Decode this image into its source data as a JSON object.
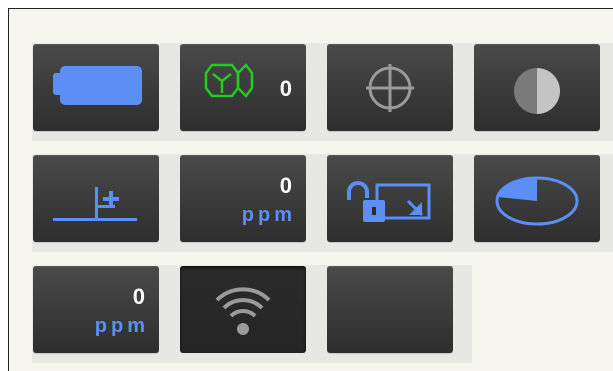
{
  "screen": {
    "status_icons": [
      {
        "id": "battery",
        "icon": "battery-icon"
      },
      {
        "id": "prism",
        "icon": "prism-icon",
        "value": "0"
      },
      {
        "id": "target",
        "icon": "crosshair-target-icon"
      },
      {
        "id": "laser",
        "icon": "half-circle-contrast-icon"
      },
      {
        "id": "instrument-height",
        "icon": "height-offset-icon"
      },
      {
        "id": "ppm-a",
        "icon": "ppm-correction",
        "value": "0",
        "unit": "ppm"
      },
      {
        "id": "lock",
        "icon": "unlock-screen-icon"
      },
      {
        "id": "disk",
        "icon": "disk-capacity-icon"
      },
      {
        "id": "ppm-b",
        "icon": "ppm-correction",
        "value": "0",
        "unit": "ppm"
      },
      {
        "id": "wireless",
        "icon": "wifi-signal-icon"
      },
      {
        "id": "blank",
        "icon": ""
      }
    ],
    "colors": {
      "panel_bg": "#f6f6ef",
      "band_bg": "#e7e7e4",
      "button_dark": "#3a3a3a",
      "accent_blue": "#5b8ff5",
      "prism_green": "#22cc22",
      "icon_gray": "#9a9a9a"
    }
  }
}
